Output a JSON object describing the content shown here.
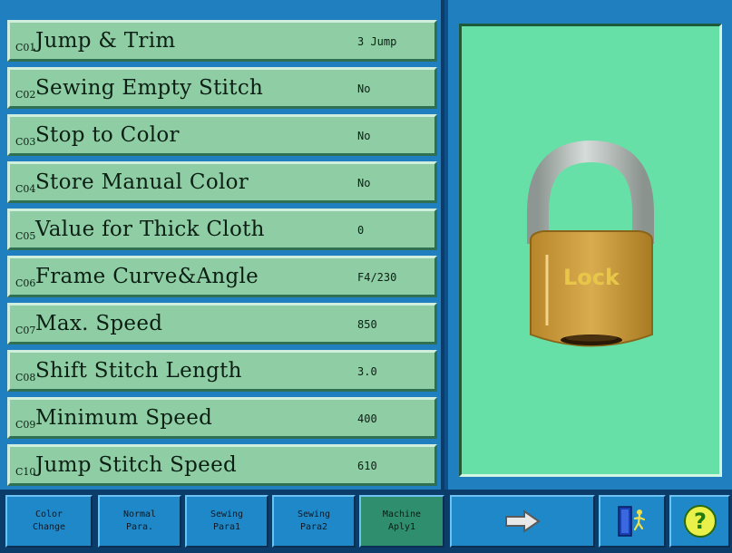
{
  "params": [
    {
      "code": "C01",
      "label": "Jump & Trim",
      "value": "3 Jump"
    },
    {
      "code": "C02",
      "label": "Sewing Empty Stitch",
      "value": "No"
    },
    {
      "code": "C03",
      "label": "Stop to Color",
      "value": "No"
    },
    {
      "code": "C04",
      "label": "Store Manual Color",
      "value": "No"
    },
    {
      "code": "C05",
      "label": "Value for Thick Cloth",
      "value": "0"
    },
    {
      "code": "C06",
      "label": "Frame Curve&Angle",
      "value": "F4/230"
    },
    {
      "code": "C07",
      "label": "Max. Speed",
      "value": "850"
    },
    {
      "code": "C08",
      "label": "Shift Stitch Length",
      "value": "3.0"
    },
    {
      "code": "C09",
      "label": "Minimum Speed",
      "value": "400"
    },
    {
      "code": "C10",
      "label": "Jump Stitch Speed",
      "value": "610"
    }
  ],
  "lock": {
    "text": "Lock"
  },
  "tabs": [
    {
      "line1": "Color",
      "line2": "Change"
    },
    {
      "line1": "Normal",
      "line2": "Para."
    },
    {
      "line1": "Sewing",
      "line2": "Para1"
    },
    {
      "line1": "Sewing",
      "line2": "Para2"
    },
    {
      "line1": "Machine",
      "line2": "Aply1"
    }
  ],
  "icons": {
    "next": "arrow-right-icon",
    "exit": "exit-door-icon",
    "help": "help-icon"
  },
  "colors": {
    "row_bg": "#8fcea4",
    "lock_bg": "#66e0a6",
    "tab_bg": "#1f88c8",
    "active_tab": "#2e8e6e"
  }
}
